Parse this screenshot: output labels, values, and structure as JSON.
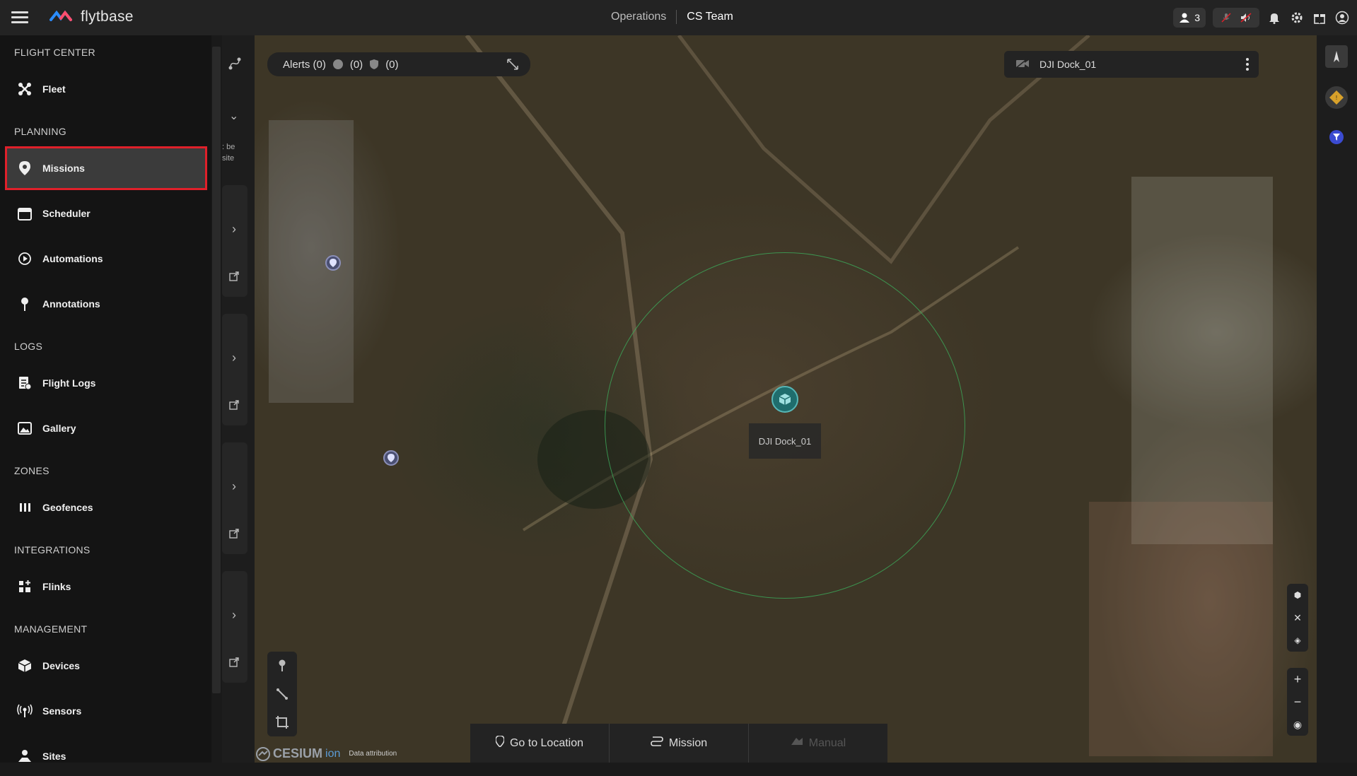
{
  "header": {
    "logo_text": "flytbase",
    "operations_label": "Operations",
    "team_label": "CS Team",
    "users_count": "3"
  },
  "sidebar": {
    "sections": [
      {
        "title": "FLIGHT CENTER",
        "items": [
          {
            "label": "Fleet",
            "icon": "drone-icon"
          }
        ]
      },
      {
        "title": "PLANNING",
        "items": [
          {
            "label": "Missions",
            "icon": "map-pin-icon"
          },
          {
            "label": "Scheduler",
            "icon": "calendar-icon"
          },
          {
            "label": "Automations",
            "icon": "automation-icon"
          },
          {
            "label": "Annotations",
            "icon": "annotation-pin-icon"
          }
        ]
      },
      {
        "title": "LOGS",
        "items": [
          {
            "label": "Flight Logs",
            "icon": "log-icon"
          },
          {
            "label": "Gallery",
            "icon": "image-icon"
          }
        ]
      },
      {
        "title": "ZONES",
        "items": [
          {
            "label": "Geofences",
            "icon": "geofence-icon"
          }
        ]
      },
      {
        "title": "INTEGRATIONS",
        "items": [
          {
            "label": "Flinks",
            "icon": "grid-plus-icon"
          }
        ]
      },
      {
        "title": "MANAGEMENT",
        "items": [
          {
            "label": "Devices",
            "icon": "cube-icon"
          },
          {
            "label": "Sensors",
            "icon": "antenna-icon"
          },
          {
            "label": "Sites",
            "icon": "site-icon"
          }
        ]
      }
    ],
    "active_item": "Missions"
  },
  "subpanel": {
    "snippet_line1": ": be",
    "snippet_line2": "site"
  },
  "alerts": {
    "label": "Alerts (0)",
    "count_a": "(0)",
    "count_b": "(0)"
  },
  "device_panel": {
    "name": "DJI Dock_01"
  },
  "map": {
    "dock_label": "DJI Dock_01",
    "attribution_brand": "CESIUM",
    "attribution_ion": "ion",
    "attribution_text": "Data attribution"
  },
  "bottom_bar": {
    "go_to_location": "Go to Location",
    "mission": "Mission",
    "manual": "Manual"
  },
  "colors": {
    "active_outline": "#e0202a",
    "range_circle": "#3caa5a",
    "dock_marker": "#1f6d6d"
  }
}
